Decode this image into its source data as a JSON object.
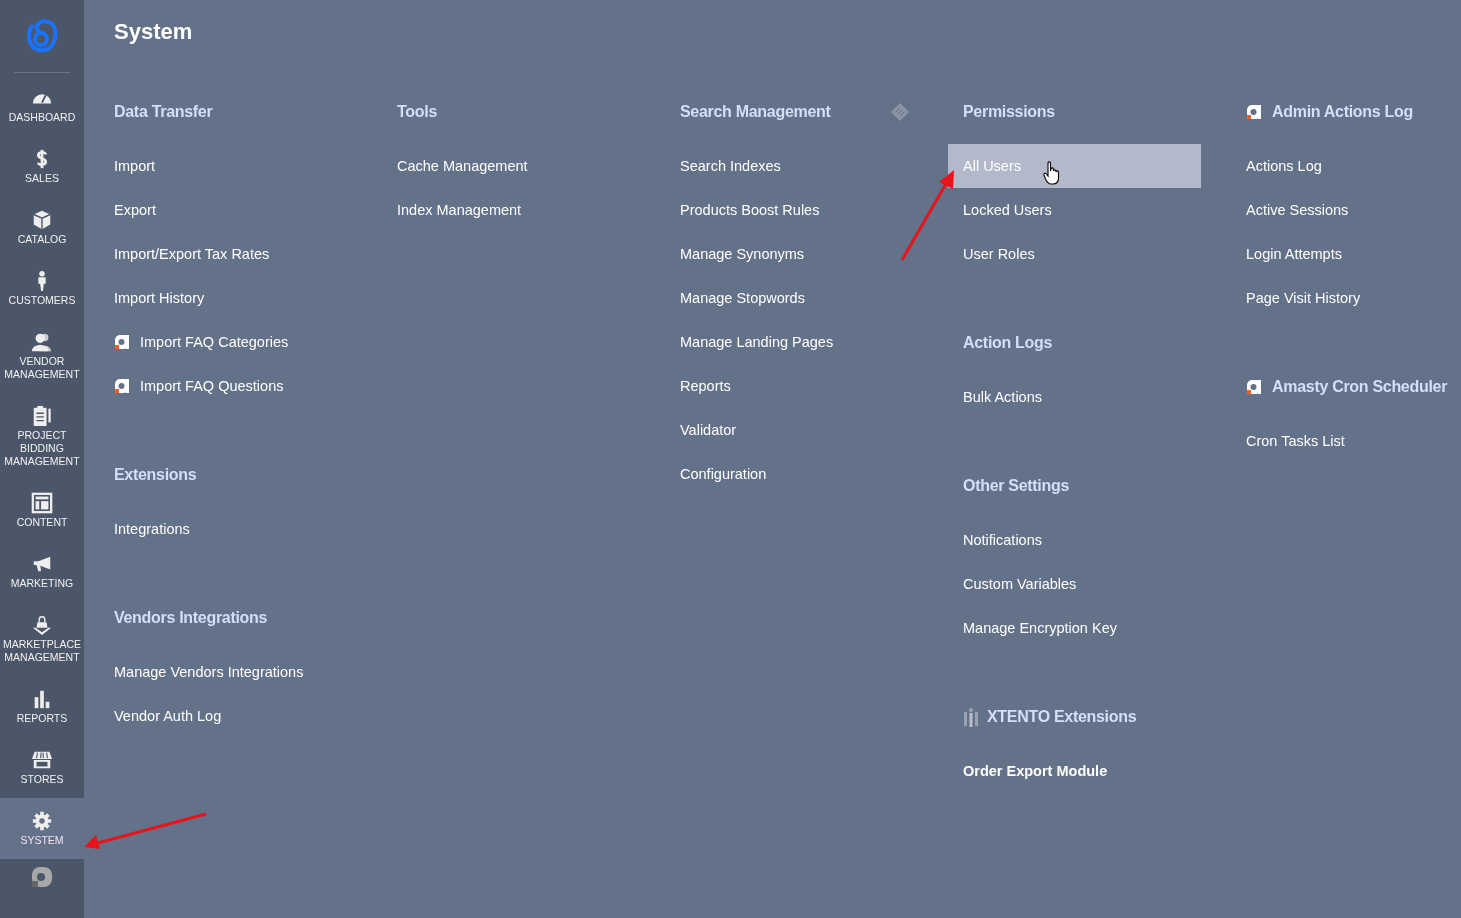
{
  "sidebar": {
    "items": [
      {
        "label": "DASHBOARD",
        "selected": false
      },
      {
        "label": "SALES",
        "selected": false
      },
      {
        "label": "CATALOG",
        "selected": false
      },
      {
        "label": "CUSTOMERS",
        "selected": false
      },
      {
        "label": "VENDOR MANAGEMENT",
        "selected": false
      },
      {
        "label": "PROJECT BIDDING MANAGEMENT",
        "selected": false
      },
      {
        "label": "CONTENT",
        "selected": false
      },
      {
        "label": "MARKETING",
        "selected": false
      },
      {
        "label": "MARKETPLACE MANAGEMENT",
        "selected": false
      },
      {
        "label": "REPORTS",
        "selected": false
      },
      {
        "label": "STORES",
        "selected": false
      },
      {
        "label": "SYSTEM",
        "selected": true
      }
    ]
  },
  "panel": {
    "title": "System",
    "columns": [
      {
        "groups": [
          {
            "heading": "Data Transfer",
            "kind": "plain",
            "items": [
              {
                "label": "Import",
                "kind": "plain",
                "selected": false
              },
              {
                "label": "Export",
                "kind": "plain",
                "selected": false
              },
              {
                "label": "Import/Export Tax Rates",
                "kind": "plain",
                "selected": false
              },
              {
                "label": "Import History",
                "kind": "plain",
                "selected": false
              },
              {
                "label": "Import FAQ Categories",
                "kind": "amasty",
                "selected": false
              },
              {
                "label": "Import FAQ Questions",
                "kind": "amasty",
                "selected": false
              }
            ]
          },
          {
            "heading": "Extensions",
            "kind": "plain",
            "items": [
              {
                "label": "Integrations",
                "kind": "plain",
                "selected": false
              }
            ]
          },
          {
            "heading": "Vendors Integrations",
            "kind": "plain",
            "items": [
              {
                "label": "Manage Vendors Integrations",
                "kind": "plain",
                "selected": false
              },
              {
                "label": "Vendor Auth Log",
                "kind": "plain",
                "selected": false
              }
            ]
          }
        ]
      },
      {
        "groups": [
          {
            "heading": "Tools",
            "kind": "plain",
            "items": [
              {
                "label": "Cache Management",
                "kind": "plain",
                "selected": false
              },
              {
                "label": "Index Management",
                "kind": "plain",
                "selected": false
              }
            ]
          }
        ]
      },
      {
        "groups": [
          {
            "heading": "Search Management",
            "kind": "diamond",
            "items": [
              {
                "label": "Search Indexes",
                "kind": "plain",
                "selected": false
              },
              {
                "label": "Products Boost Rules",
                "kind": "plain",
                "selected": false
              },
              {
                "label": "Manage Synonyms",
                "kind": "plain",
                "selected": false
              },
              {
                "label": "Manage Stopwords",
                "kind": "plain",
                "selected": false
              },
              {
                "label": "Manage Landing Pages",
                "kind": "plain",
                "selected": false
              },
              {
                "label": "Reports",
                "kind": "plain",
                "selected": false
              },
              {
                "label": "Validator",
                "kind": "plain",
                "selected": false
              },
              {
                "label": "Configuration",
                "kind": "plain",
                "selected": false
              }
            ]
          }
        ]
      },
      {
        "groups": [
          {
            "heading": "Permissions",
            "kind": "plain",
            "items": [
              {
                "label": "All Users",
                "kind": "plain",
                "selected": true
              },
              {
                "label": "Locked Users",
                "kind": "plain",
                "selected": false
              },
              {
                "label": "User Roles",
                "kind": "plain",
                "selected": false
              }
            ]
          },
          {
            "heading": "Action Logs",
            "kind": "plain",
            "items": [
              {
                "label": "Bulk Actions",
                "kind": "plain",
                "selected": false
              }
            ]
          },
          {
            "heading": "Other Settings",
            "kind": "plain",
            "items": [
              {
                "label": "Notifications",
                "kind": "plain",
                "selected": false
              },
              {
                "label": "Custom Variables",
                "kind": "plain",
                "selected": false
              },
              {
                "label": "Manage Encryption Key",
                "kind": "plain",
                "selected": false
              }
            ]
          },
          {
            "heading": "XTENTO Extensions",
            "kind": "xtento",
            "items": [
              {
                "label": "Order Export Module",
                "kind": "strong",
                "selected": false
              }
            ]
          }
        ]
      },
      {
        "groups": [
          {
            "heading": "Admin Actions Log",
            "kind": "amasty",
            "items": [
              {
                "label": "Actions Log",
                "kind": "plain",
                "selected": false
              },
              {
                "label": "Active Sessions",
                "kind": "plain",
                "selected": false
              },
              {
                "label": "Login Attempts",
                "kind": "plain",
                "selected": false
              },
              {
                "label": "Page Visit History",
                "kind": "plain",
                "selected": false
              }
            ]
          },
          {
            "heading": "Amasty Cron Scheduler",
            "kind": "amasty",
            "items": [
              {
                "label": "Cron Tasks List",
                "kind": "plain",
                "selected": false
              }
            ]
          }
        ]
      }
    ]
  }
}
